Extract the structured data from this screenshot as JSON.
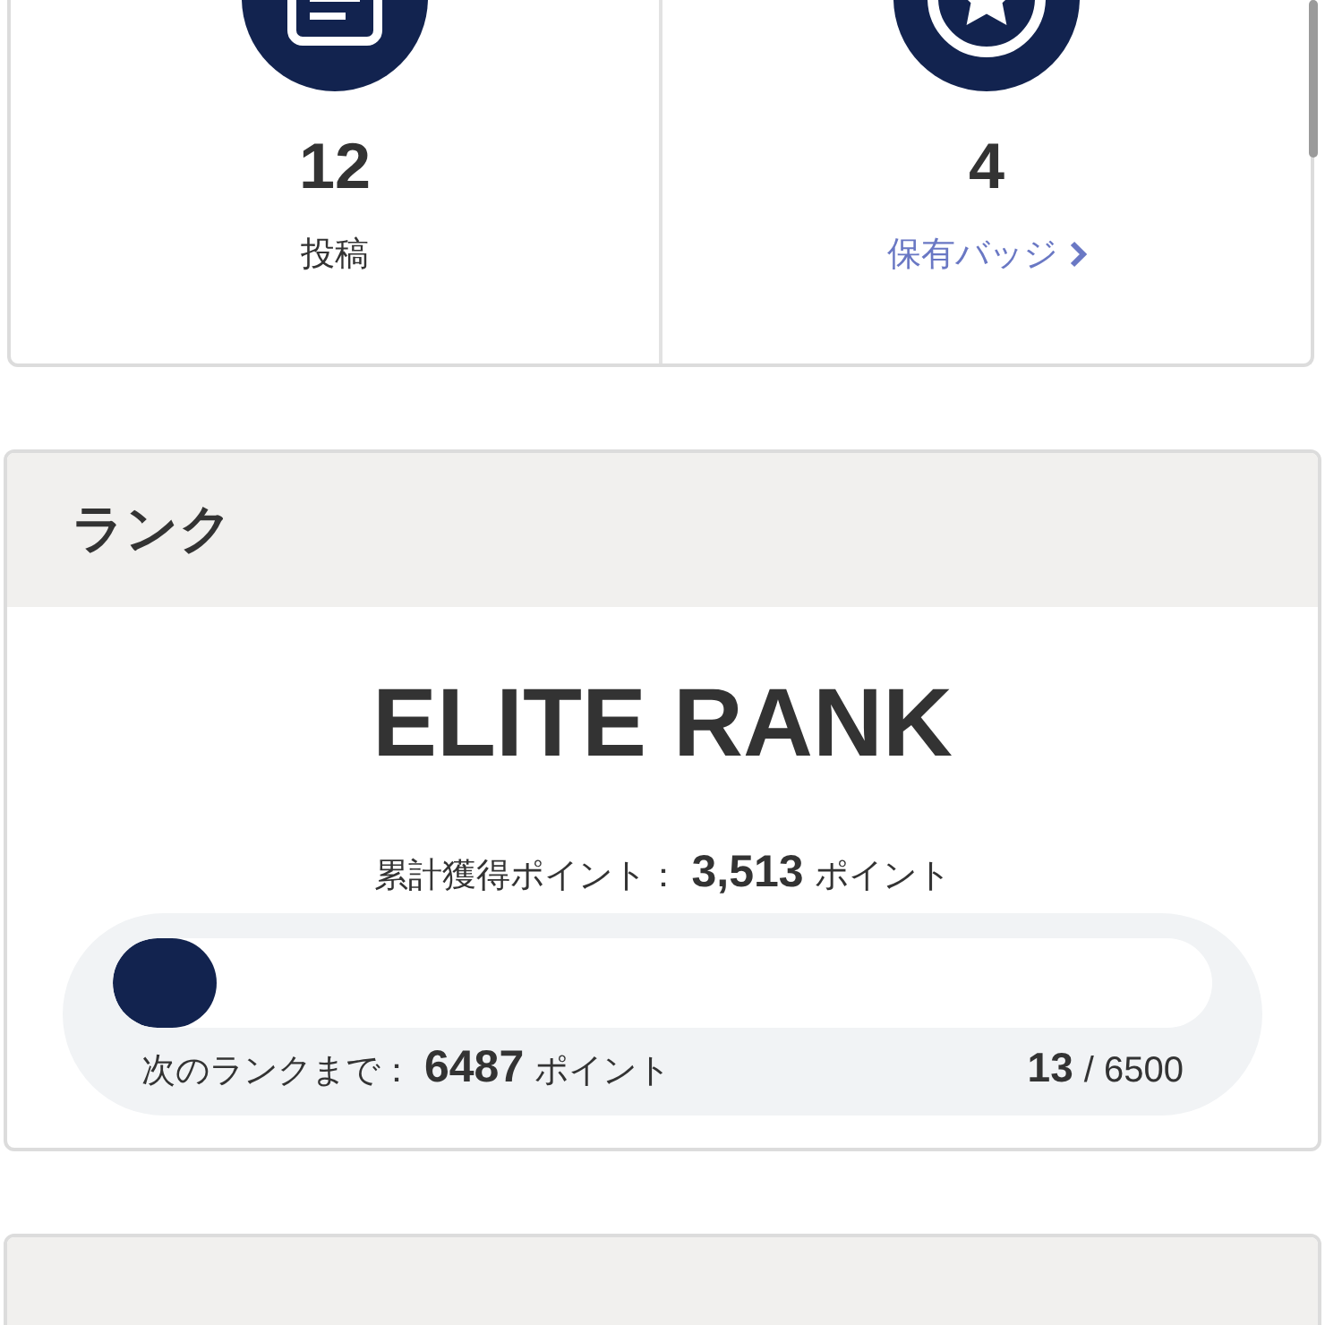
{
  "stats": [
    {
      "kind": "posts",
      "value": "12",
      "label": "投稿",
      "link": false
    },
    {
      "kind": "badges",
      "value": "4",
      "label": "保有バッジ",
      "link": true
    }
  ],
  "rank": {
    "heading": "ランク",
    "name": "ELITE RANK",
    "total_label": "累計獲得ポイント：",
    "total_value": "3,513",
    "total_unit": "ポイント",
    "level": 0.002,
    "next_label": "次のランクまで：",
    "next_value": "6487",
    "next_unit": "ポイント",
    "current": "13",
    "separator": "/",
    "goal": "6500"
  },
  "history": {
    "kind": "section"
  }
}
